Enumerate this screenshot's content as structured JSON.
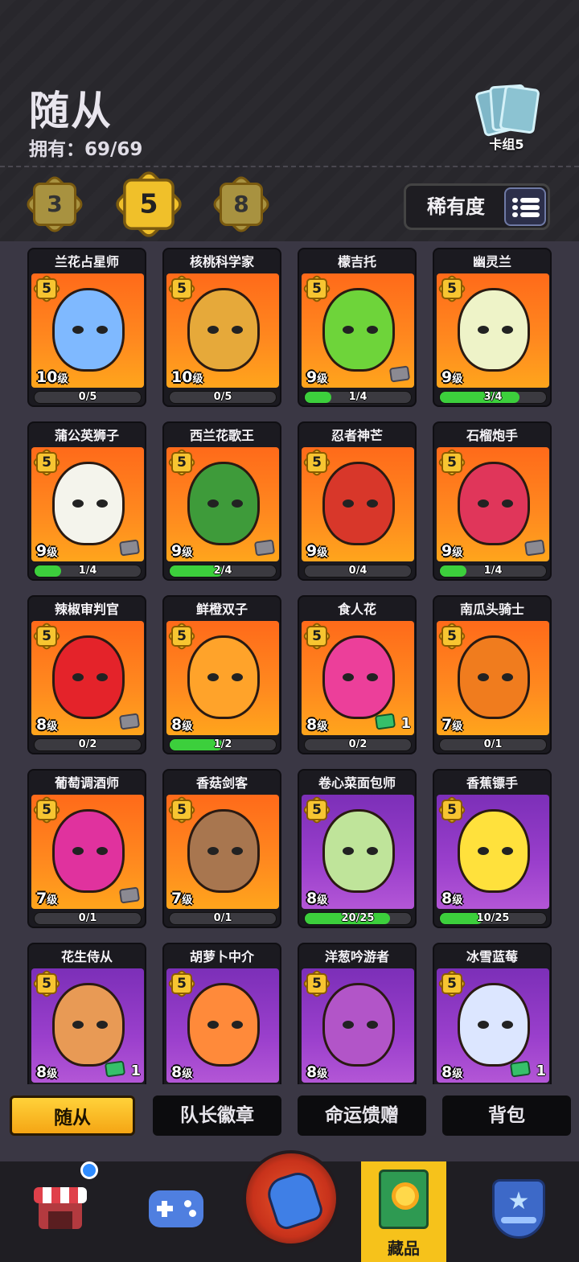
{
  "header": {
    "title": "随从",
    "owned_label": "拥有：69/69",
    "deck_label": "卡组5",
    "deck_icon": "cards-icon"
  },
  "filters": {
    "levels": [
      "3",
      "5",
      "8"
    ],
    "selected_level": "5",
    "rarity_label": "稀有度",
    "sort_icon": "list-sort-icon"
  },
  "cards": [
    {
      "name": "兰花占星师",
      "rank": "5",
      "level": "10",
      "level_unit": "级",
      "progress": "0/5",
      "progress_fraction": 0,
      "bg": "orange",
      "color": "#7fb9ff",
      "dup": ""
    },
    {
      "name": "核桃科学家",
      "rank": "5",
      "level": "10",
      "level_unit": "级",
      "progress": "0/5",
      "progress_fraction": 0,
      "bg": "orange",
      "color": "#e6a93a",
      "dup": ""
    },
    {
      "name": "檬吉托",
      "rank": "5",
      "level": "9",
      "level_unit": "级",
      "progress": "1/4",
      "progress_fraction": 0.25,
      "bg": "orange",
      "color": "#6ed43a",
      "dup": "",
      "card_icon": true
    },
    {
      "name": "幽灵兰",
      "rank": "5",
      "level": "9",
      "level_unit": "级",
      "progress": "3/4",
      "progress_fraction": 0.75,
      "bg": "orange",
      "color": "#eef3c8",
      "dup": ""
    },
    {
      "name": "蒲公英狮子",
      "rank": "5",
      "level": "9",
      "level_unit": "级",
      "progress": "1/4",
      "progress_fraction": 0.25,
      "bg": "orange",
      "color": "#f4f4ec",
      "dup": "",
      "card_icon": true
    },
    {
      "name": "西兰花歌王",
      "rank": "5",
      "level": "9",
      "level_unit": "级",
      "progress": "2/4",
      "progress_fraction": 0.5,
      "bg": "orange",
      "color": "#3e9b3a",
      "dup": "",
      "card_icon": true
    },
    {
      "name": "忍者神芒",
      "rank": "5",
      "level": "9",
      "level_unit": "级",
      "progress": "0/4",
      "progress_fraction": 0,
      "bg": "orange",
      "color": "#d8372a",
      "dup": ""
    },
    {
      "name": "石榴炮手",
      "rank": "5",
      "level": "9",
      "level_unit": "级",
      "progress": "1/4",
      "progress_fraction": 0.25,
      "bg": "orange",
      "color": "#e0365a",
      "dup": "",
      "card_icon": true
    },
    {
      "name": "辣椒审判官",
      "rank": "5",
      "level": "8",
      "level_unit": "级",
      "progress": "0/2",
      "progress_fraction": 0,
      "bg": "orange",
      "color": "#e4232a",
      "dup": "",
      "card_icon": true
    },
    {
      "name": "鲜橙双子",
      "rank": "5",
      "level": "8",
      "level_unit": "级",
      "progress": "1/2",
      "progress_fraction": 0.5,
      "bg": "orange",
      "color": "#ffa32a",
      "dup": ""
    },
    {
      "name": "食人花",
      "rank": "5",
      "level": "8",
      "level_unit": "级",
      "progress": "0/2",
      "progress_fraction": 0,
      "bg": "orange",
      "color": "#ec3f9a",
      "dup": "1",
      "card_icon": true,
      "card_icon_green": true
    },
    {
      "name": "南瓜头骑士",
      "rank": "5",
      "level": "7",
      "level_unit": "级",
      "progress": "0/1",
      "progress_fraction": 0,
      "bg": "orange",
      "color": "#f07c1e",
      "dup": ""
    },
    {
      "name": "葡萄调酒师",
      "rank": "5",
      "level": "7",
      "level_unit": "级",
      "progress": "0/1",
      "progress_fraction": 0,
      "bg": "orange",
      "color": "#e0329e",
      "dup": "",
      "card_icon": true
    },
    {
      "name": "香菇剑客",
      "rank": "5",
      "level": "7",
      "level_unit": "级",
      "progress": "0/1",
      "progress_fraction": 0,
      "bg": "orange",
      "color": "#a8764f",
      "dup": ""
    },
    {
      "name": "卷心菜面包师",
      "rank": "5",
      "level": "8",
      "level_unit": "级",
      "progress": "20/25",
      "progress_fraction": 0.8,
      "bg": "purple",
      "color": "#bfe49a",
      "dup": ""
    },
    {
      "name": "香蕉镖手",
      "rank": "5",
      "level": "8",
      "level_unit": "级",
      "progress": "10/25",
      "progress_fraction": 0.4,
      "bg": "purple",
      "color": "#ffe13c",
      "dup": ""
    },
    {
      "name": "花生侍从",
      "rank": "5",
      "level": "8",
      "level_unit": "级",
      "progress": "",
      "progress_fraction": 0,
      "bg": "purple",
      "color": "#e89a55",
      "dup": "1",
      "card_icon": true,
      "card_icon_green": true
    },
    {
      "name": "胡萝卜中介",
      "rank": "5",
      "level": "8",
      "level_unit": "级",
      "progress": "",
      "progress_fraction": 0,
      "bg": "purple",
      "color": "#ff8a3a",
      "dup": ""
    },
    {
      "name": "洋葱吟游者",
      "rank": "5",
      "level": "8",
      "level_unit": "级",
      "progress": "",
      "progress_fraction": 0,
      "bg": "purple",
      "color": "#b255c8",
      "dup": ""
    },
    {
      "name": "冰雪蓝莓",
      "rank": "5",
      "level": "8",
      "level_unit": "级",
      "progress": "",
      "progress_fraction": 0,
      "bg": "purple",
      "color": "#dce6ff",
      "dup": "1",
      "card_icon": true,
      "card_icon_green": true
    }
  ],
  "subtabs": [
    {
      "label": "随从",
      "active": true
    },
    {
      "label": "队长徽章",
      "active": false
    },
    {
      "label": "命运馈赠",
      "active": false
    },
    {
      "label": "背包",
      "active": false
    }
  ],
  "bottom_nav": [
    {
      "icon": "shop-icon",
      "label": "",
      "active": false,
      "notification": true
    },
    {
      "icon": "gamepad-icon",
      "label": "",
      "active": false
    },
    {
      "icon": "boxing-glove-icon",
      "label": "",
      "active": false
    },
    {
      "icon": "collection-book-icon",
      "label": "藏品",
      "active": true
    },
    {
      "icon": "shield-star-icon",
      "label": "",
      "active": false
    }
  ],
  "colors": {
    "accent": "#f6c21b",
    "progress_green": "#3ccf3c",
    "card_orange": "#ff7a1d",
    "card_purple": "#9a3fcc"
  }
}
